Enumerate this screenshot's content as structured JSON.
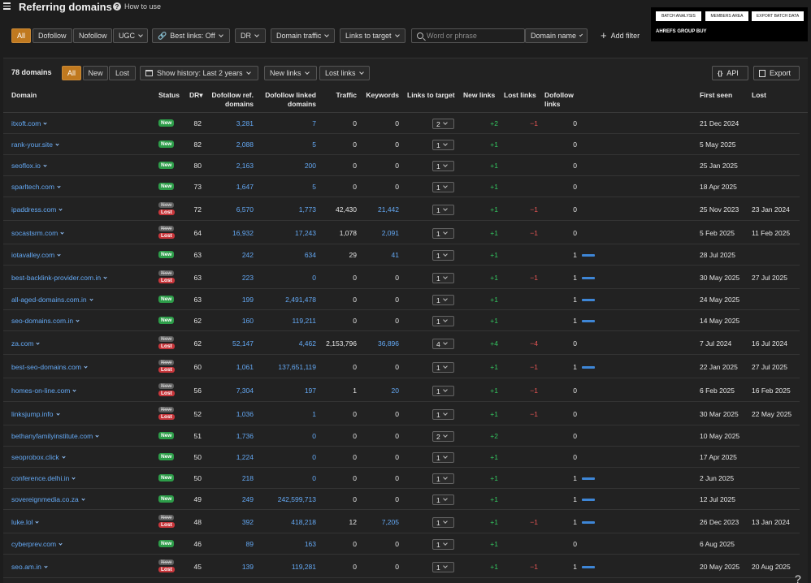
{
  "header": {
    "title": "Referring domains",
    "how_to_use": "How to use"
  },
  "group_buy": {
    "buttons": [
      "BATCH ANALYSIS",
      "MEMBERS AREA",
      "EXPORT BATCH DATA"
    ],
    "label": "AHREFS GROUP BUY"
  },
  "filters": {
    "link_types": [
      "All",
      "Dofollow",
      "Nofollow",
      "UGC"
    ],
    "best_links": "Best links: Off",
    "dr": "DR",
    "domain_traffic": "Domain traffic",
    "links_to_target": "Links to target",
    "search_placeholder": "Word or phrase",
    "search_value": "",
    "search_scope": "Domain name",
    "add_filter": "Add filter"
  },
  "toolbar": {
    "count": "78 domains",
    "tabs": [
      "All",
      "New",
      "Lost"
    ],
    "history": "Show history: Last 2 years",
    "new_links": "New links",
    "lost_links": "Lost links",
    "api": "API",
    "export": "Export"
  },
  "columns": {
    "domain": "Domain",
    "status": "Status",
    "dr": "DR",
    "dofollow_ref": "Dofollow ref.\ndomains",
    "dofollow_linked": "Dofollow linked\ndomains",
    "traffic": "Traffic",
    "keywords": "Keywords",
    "links_to_target": "Links to target",
    "new_links": "New links",
    "lost_links": "Lost links",
    "dofollow_links": "Dofollow\nlinks",
    "first_seen": "First seen",
    "lost": "Lost"
  },
  "colors": {
    "accent": "#c0791f",
    "link": "#64a9f5",
    "new": "#2d9d49",
    "lost": "#c8363b"
  },
  "rows": [
    {
      "domain": "itxoft.com",
      "status": "new",
      "dr": "82",
      "ref": "3,281",
      "linked": "7",
      "traffic": "0",
      "keywords": "0",
      "ltt": "2",
      "new": "+2",
      "lost": "−1",
      "dofollow": "0",
      "first": "21 Dec 2024",
      "lostd": ""
    },
    {
      "domain": "rank-your.site",
      "status": "new",
      "dr": "82",
      "ref": "2,088",
      "linked": "5",
      "traffic": "0",
      "keywords": "0",
      "ltt": "1",
      "new": "+1",
      "lost": "",
      "dofollow": "0",
      "first": "5 May 2025",
      "lostd": ""
    },
    {
      "domain": "seoflox.io",
      "status": "new",
      "dr": "80",
      "ref": "2,163",
      "linked": "200",
      "traffic": "0",
      "keywords": "0",
      "ltt": "1",
      "new": "+1",
      "lost": "",
      "dofollow": "0",
      "first": "25 Jan 2025",
      "lostd": ""
    },
    {
      "domain": "sparltech.com",
      "status": "new",
      "dr": "73",
      "ref": "1,647",
      "linked": "5",
      "traffic": "0",
      "keywords": "0",
      "ltt": "1",
      "new": "+1",
      "lost": "",
      "dofollow": "0",
      "first": "18 Apr 2025",
      "lostd": ""
    },
    {
      "domain": "ipaddress.com",
      "status": "lost",
      "dr": "72",
      "ref": "6,570",
      "linked": "1,773",
      "traffic": "42,430",
      "keywords": "21,442",
      "ltt": "1",
      "new": "+1",
      "lost": "−1",
      "dofollow": "0",
      "first": "25 Nov 2023",
      "lostd": "23 Jan 2024"
    },
    {
      "domain": "socastsrm.com",
      "status": "lost",
      "dr": "64",
      "ref": "16,932",
      "linked": "17,243",
      "traffic": "1,078",
      "keywords": "2,091",
      "ltt": "1",
      "new": "+1",
      "lost": "−1",
      "dofollow": "0",
      "first": "5 Feb 2025",
      "lostd": "11 Feb 2025"
    },
    {
      "domain": "iotavalley.com",
      "status": "new",
      "dr": "63",
      "ref": "242",
      "linked": "634",
      "traffic": "29",
      "keywords": "41",
      "ltt": "1",
      "new": "+1",
      "lost": "",
      "dofollow": "1",
      "first": "28 Jul 2025",
      "lostd": ""
    },
    {
      "domain": "best-backlink-provider.com.in",
      "status": "lost",
      "dr": "63",
      "ref": "223",
      "linked": "0",
      "traffic": "0",
      "keywords": "0",
      "ltt": "1",
      "new": "+1",
      "lost": "−1",
      "dofollow": "1",
      "first": "30 May 2025",
      "lostd": "27 Jul 2025"
    },
    {
      "domain": "all-aged-domains.com.in",
      "status": "new",
      "dr": "63",
      "ref": "199",
      "linked": "2,491,478",
      "traffic": "0",
      "keywords": "0",
      "ltt": "1",
      "new": "+1",
      "lost": "",
      "dofollow": "1",
      "first": "24 May 2025",
      "lostd": ""
    },
    {
      "domain": "seo-domains.com.in",
      "status": "new",
      "dr": "62",
      "ref": "160",
      "linked": "119,211",
      "traffic": "0",
      "keywords": "0",
      "ltt": "1",
      "new": "+1",
      "lost": "",
      "dofollow": "1",
      "first": "14 May 2025",
      "lostd": ""
    },
    {
      "domain": "za.com",
      "status": "lost",
      "dr": "62",
      "ref": "52,147",
      "linked": "4,462",
      "traffic": "2,153,796",
      "keywords": "36,896",
      "ltt": "4",
      "new": "+4",
      "lost": "−4",
      "dofollow": "0",
      "first": "7 Jul 2024",
      "lostd": "16 Jul 2024"
    },
    {
      "domain": "best-seo-domains.com",
      "status": "lost",
      "dr": "60",
      "ref": "1,061",
      "linked": "137,651,119",
      "traffic": "0",
      "keywords": "0",
      "ltt": "1",
      "new": "+1",
      "lost": "−1",
      "dofollow": "1",
      "first": "22 Jan 2025",
      "lostd": "27 Jul 2025"
    },
    {
      "domain": "homes-on-line.com",
      "status": "lost",
      "dr": "56",
      "ref": "7,304",
      "linked": "197",
      "traffic": "1",
      "keywords": "20",
      "ltt": "1",
      "new": "+1",
      "lost": "−1",
      "dofollow": "0",
      "first": "6 Feb 2025",
      "lostd": "16 Feb 2025"
    },
    {
      "domain": "linksjump.info",
      "status": "lost",
      "dr": "52",
      "ref": "1,036",
      "linked": "1",
      "traffic": "0",
      "keywords": "0",
      "ltt": "1",
      "new": "+1",
      "lost": "−1",
      "dofollow": "0",
      "first": "30 Mar 2025",
      "lostd": "22 May 2025"
    },
    {
      "domain": "bethanyfamilyinstitute.com",
      "status": "new",
      "dr": "51",
      "ref": "1,736",
      "linked": "0",
      "traffic": "0",
      "keywords": "0",
      "ltt": "2",
      "new": "+2",
      "lost": "",
      "dofollow": "0",
      "first": "10 May 2025",
      "lostd": ""
    },
    {
      "domain": "seoprobox.click",
      "status": "new",
      "dr": "50",
      "ref": "1,224",
      "linked": "0",
      "traffic": "0",
      "keywords": "0",
      "ltt": "1",
      "new": "+1",
      "lost": "",
      "dofollow": "0",
      "first": "17 Apr 2025",
      "lostd": ""
    },
    {
      "domain": "conference.delhi.in",
      "status": "new",
      "dr": "50",
      "ref": "218",
      "linked": "0",
      "traffic": "0",
      "keywords": "0",
      "ltt": "1",
      "new": "+1",
      "lost": "",
      "dofollow": "1",
      "first": "2 Jun 2025",
      "lostd": ""
    },
    {
      "domain": "sovereignmedia.co.za",
      "status": "new",
      "dr": "49",
      "ref": "249",
      "linked": "242,599,713",
      "traffic": "0",
      "keywords": "0",
      "ltt": "1",
      "new": "+1",
      "lost": "",
      "dofollow": "1",
      "first": "12 Jul 2025",
      "lostd": ""
    },
    {
      "domain": "luke.lol",
      "status": "lost",
      "dr": "48",
      "ref": "392",
      "linked": "418,218",
      "traffic": "12",
      "keywords": "7,205",
      "ltt": "1",
      "new": "+1",
      "lost": "−1",
      "dofollow": "1",
      "first": "26 Dec 2023",
      "lostd": "13 Jan 2024"
    },
    {
      "domain": "cyberprev.com",
      "status": "new",
      "dr": "46",
      "ref": "89",
      "linked": "163",
      "traffic": "0",
      "keywords": "0",
      "ltt": "1",
      "new": "+1",
      "lost": "",
      "dofollow": "0",
      "first": "6 Aug 2025",
      "lostd": ""
    },
    {
      "domain": "seo.am.in",
      "status": "lost",
      "dr": "45",
      "ref": "139",
      "linked": "119,281",
      "traffic": "0",
      "keywords": "0",
      "ltt": "1",
      "new": "+1",
      "lost": "−1",
      "dofollow": "1",
      "first": "20 May 2025",
      "lostd": "20 Aug 2025"
    }
  ],
  "status_labels": {
    "new": "New",
    "lost": "Lost"
  },
  "help": "?"
}
